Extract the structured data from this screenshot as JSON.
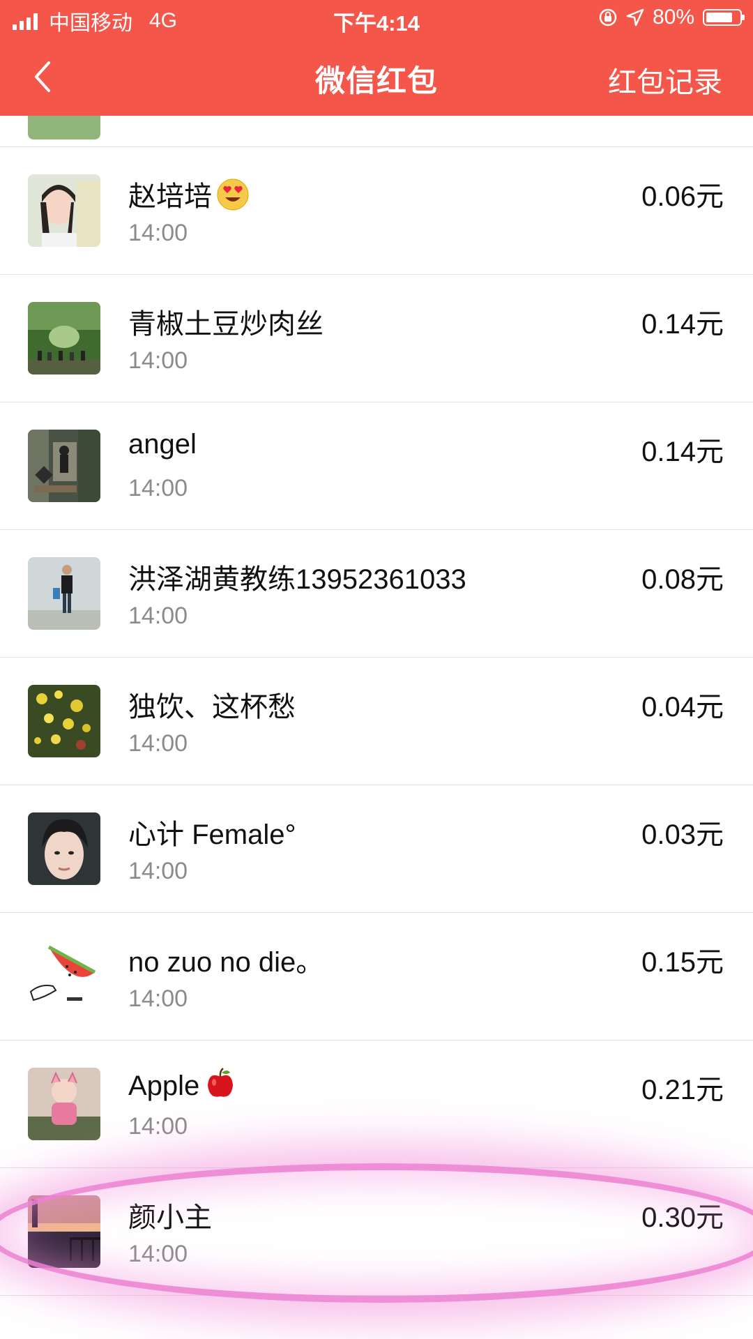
{
  "status_bar": {
    "carrier": "中国移动",
    "network": "4G",
    "time": "下午4:14",
    "battery": "80%",
    "battery_level": 0.8
  },
  "nav": {
    "back_icon": "chevron-left-icon",
    "title": "微信红包",
    "right_label": "红包记录"
  },
  "records": [
    {
      "name": "赵培培",
      "emoji": "heart-eyes-emoji",
      "time": "14:00",
      "amount": "0.06元"
    },
    {
      "name": "青椒土豆炒肉丝",
      "time": "14:00",
      "amount": "0.14元"
    },
    {
      "name": "angel",
      "time": "14:00",
      "amount": "0.14元"
    },
    {
      "name": "洪泽湖黄教练13952361033",
      "time": "14:00",
      "amount": "0.08元"
    },
    {
      "name": "独饮、这杯愁",
      "time": "14:00",
      "amount": "0.04元"
    },
    {
      "name": "心计 Female°",
      "time": "14:00",
      "amount": "0.03元"
    },
    {
      "name": "no zuo no die。",
      "time": "14:00",
      "amount": "0.15元"
    },
    {
      "name": "Apple",
      "emoji": "red-apple-emoji",
      "time": "14:00",
      "amount": "0.21元"
    },
    {
      "name": "颜小主",
      "time": "14:00",
      "amount": "0.30元"
    }
  ],
  "colors": {
    "header_bg": "#f4574a",
    "highlight": "#ec82d2"
  }
}
